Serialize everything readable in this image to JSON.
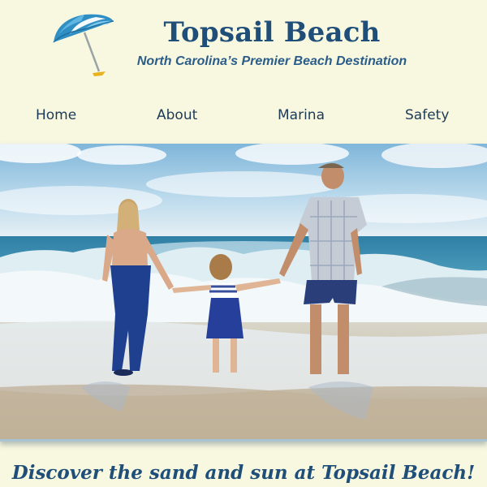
{
  "header": {
    "title": "Topsail Beach",
    "tagline": "North Carolina’s Premier Beach Destination",
    "logo_icon": "beach-umbrella-icon"
  },
  "nav": {
    "items": [
      {
        "label": "Home"
      },
      {
        "label": "About"
      },
      {
        "label": "Marina"
      },
      {
        "label": "Safety"
      }
    ]
  },
  "hero": {
    "image": "family-at-beach-photo"
  },
  "main": {
    "headline": "Discover the sand and sun at Topsail Beach!"
  },
  "colors": {
    "background": "#f8f7df",
    "title": "#1f4e79",
    "nav_text": "#1d3b57"
  }
}
